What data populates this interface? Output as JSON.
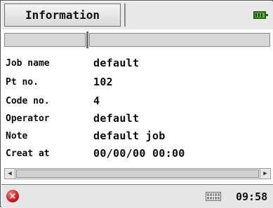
{
  "header": {
    "title": "Information",
    "battery_icon": "battery-full-icon"
  },
  "table": {
    "columns": [
      "",
      ""
    ]
  },
  "fields": [
    {
      "label": "Job name",
      "value": "default"
    },
    {
      "label": "Pt no.",
      "value": "102"
    },
    {
      "label": "Code no.",
      "value": "4"
    },
    {
      "label": "Operator",
      "value": "default"
    },
    {
      "label": "Note",
      "value": "default job"
    },
    {
      "label": "Creat at",
      "value": "00/00/00 00:00"
    }
  ],
  "scrollbar": {
    "left_arrow": "◀",
    "right_arrow": "▶"
  },
  "status": {
    "close_symbol": "×",
    "time": "09:58"
  },
  "colors": {
    "battery": "#58b92a",
    "close": "#d11a1a"
  }
}
